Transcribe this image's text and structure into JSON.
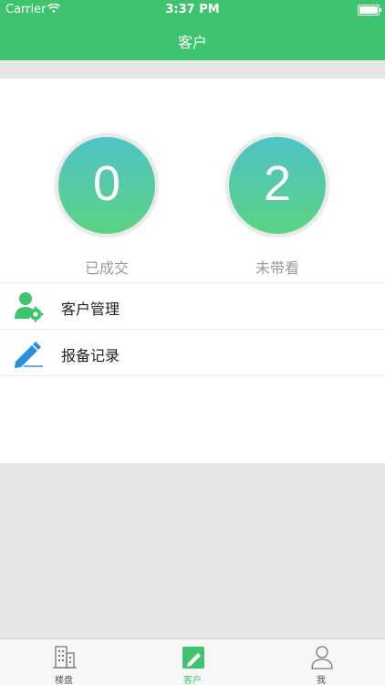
{
  "status_bar": {
    "carrier": "Carrier",
    "time": "3:37 PM"
  },
  "nav": {
    "title": "客户"
  },
  "stats": [
    {
      "value": "0",
      "label": "已成交"
    },
    {
      "value": "2",
      "label": "未带看"
    }
  ],
  "menu": [
    {
      "label": "客户管理",
      "icon": "user-gear-icon"
    },
    {
      "label": "报备记录",
      "icon": "pen-icon"
    }
  ],
  "tabs": [
    {
      "label": "楼盘",
      "icon": "building-icon",
      "active": false
    },
    {
      "label": "客户",
      "icon": "edit-icon",
      "active": true
    },
    {
      "label": "我",
      "icon": "person-icon",
      "active": false
    }
  ],
  "colors": {
    "accent": "#3ec46e",
    "circle_top": "#4fc3c6",
    "circle_bottom": "#5bd383",
    "icon_blue": "#2b8fe0"
  }
}
